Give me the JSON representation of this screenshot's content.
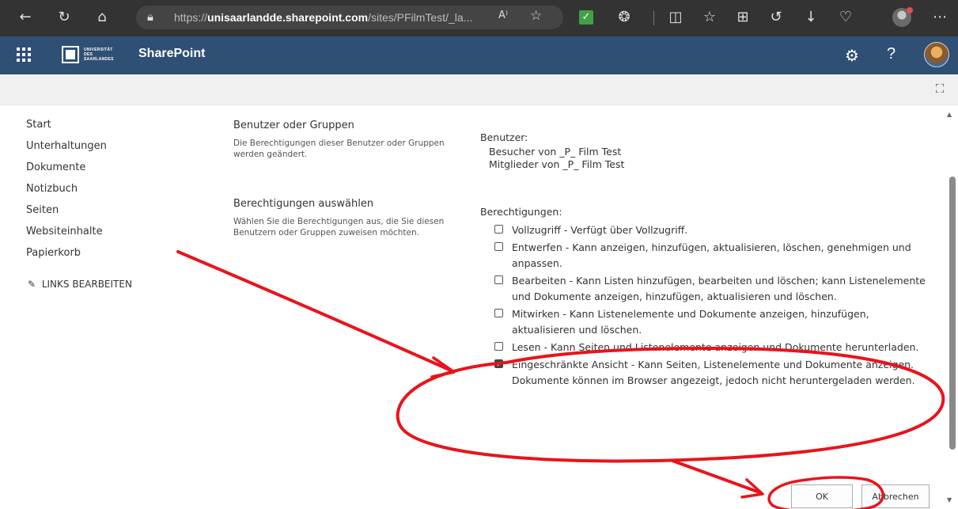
{
  "browser": {
    "url_prefix": "https://",
    "url_host": "unisaarlandde.sharepoint.com",
    "url_path": "/sites/PFilmTest/_la...",
    "readaloud": "A⁾",
    "menu": "⋯"
  },
  "suite": {
    "logo_text_1": "UNIVERSITÄT",
    "logo_text_2": "DES",
    "logo_text_3": "SAARLANDES",
    "title": "SharePoint",
    "help": "?"
  },
  "leftnav": {
    "items": [
      "Start",
      "Unterhaltungen",
      "Dokumente",
      "Notizbuch",
      "Seiten",
      "Websiteinhalte",
      "Papierkorb"
    ],
    "edit_links": "LINKS BEARBEITEN"
  },
  "users_section": {
    "title": "Benutzer oder Gruppen",
    "desc": "Die Berechtigungen dieser Benutzer oder Gruppen werden geändert."
  },
  "perms_section": {
    "title": "Berechtigungen auswählen",
    "desc": "Wählen Sie die Berechtigungen aus, die Sie diesen Benutzern oder Gruppen zuweisen möchten."
  },
  "users": {
    "label": "Benutzer:",
    "list": [
      "Besucher von _P_ Film Test",
      "Mitglieder von _P_ Film Test"
    ]
  },
  "permissions": {
    "label": "Berechtigungen:",
    "items": [
      {
        "text": "Vollzugriff - Verfügt über Vollzugriff.",
        "checked": false
      },
      {
        "text": "Entwerfen - Kann anzeigen, hinzufügen, aktualisieren, löschen, genehmigen und anpassen.",
        "checked": false
      },
      {
        "text": "Bearbeiten - Kann Listen hinzufügen, bearbeiten und löschen; kann Listenelemente und Dokumente anzeigen, hinzufügen, aktualisieren und löschen.",
        "checked": false
      },
      {
        "text": "Mitwirken - Kann Listenelemente und Dokumente anzeigen, hinzufügen, aktualisieren und löschen.",
        "checked": false
      },
      {
        "text": "Lesen - Kann Seiten und Listenelemente anzeigen und Dokumente herunterladen.",
        "checked": false
      },
      {
        "text": "Eingeschränkte Ansicht - Kann Seiten, Listenelemente und Dokumente anzeigen. Dokumente können im Browser angezeigt, jedoch nicht heruntergeladen werden.",
        "checked": true
      }
    ]
  },
  "buttons": {
    "ok": "OK",
    "cancel": "Abbrechen"
  },
  "colors": {
    "suite_bar": "#2f4f74",
    "annotation": "#e8141c"
  }
}
